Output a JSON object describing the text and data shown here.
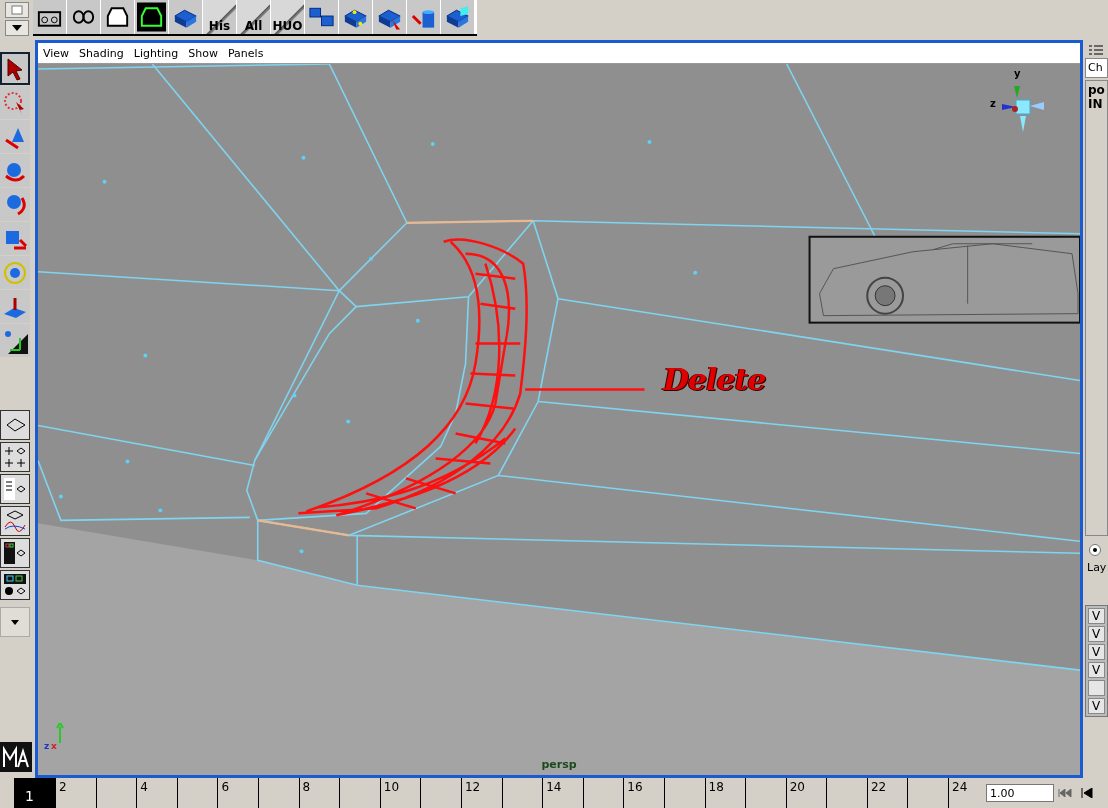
{
  "shelf": {
    "labeled_buttons": [
      {
        "label": "His"
      },
      {
        "label": "All"
      },
      {
        "label": "HUO"
      }
    ]
  },
  "viewport": {
    "menu": [
      "View",
      "Shading",
      "Lighting",
      "Show",
      "Panels"
    ],
    "view_cube_axes": [
      "y",
      "z"
    ],
    "origin_axes": [
      "z",
      "x"
    ],
    "camera": "persp",
    "annotation": "Delete"
  },
  "channel_box": {
    "tab": "Ch",
    "rows": [
      "po",
      "IN"
    ]
  },
  "layer_editor": {
    "radio_selected": true,
    "label": "Lay",
    "rows": [
      {
        "visibility": "V"
      },
      {
        "visibility": "V"
      },
      {
        "visibility": "V"
      },
      {
        "visibility": "V"
      },
      {},
      {
        "visibility": "V"
      }
    ]
  },
  "timeline": {
    "frames": [
      {
        "label": "1",
        "selected": true
      },
      {
        "label": "2",
        "selected": false
      },
      {
        "selected": false
      },
      {
        "label": "4",
        "selected": false
      },
      {
        "selected": false
      },
      {
        "label": "6",
        "selected": false
      },
      {
        "selected": false
      },
      {
        "label": "8",
        "selected": false
      },
      {
        "selected": false
      },
      {
        "label": "10",
        "selected": false
      },
      {
        "selected": false
      },
      {
        "label": "12",
        "selected": false
      },
      {
        "selected": false
      },
      {
        "label": "14",
        "selected": false
      },
      {
        "selected": false
      },
      {
        "label": "16",
        "selected": false
      },
      {
        "selected": false
      },
      {
        "label": "18",
        "selected": false
      },
      {
        "selected": false
      },
      {
        "label": "20",
        "selected": false
      },
      {
        "selected": false
      },
      {
        "label": "22",
        "selected": false
      },
      {
        "selected": false
      },
      {
        "label": "24",
        "selected": false
      }
    ],
    "frame_field": "1.00"
  }
}
